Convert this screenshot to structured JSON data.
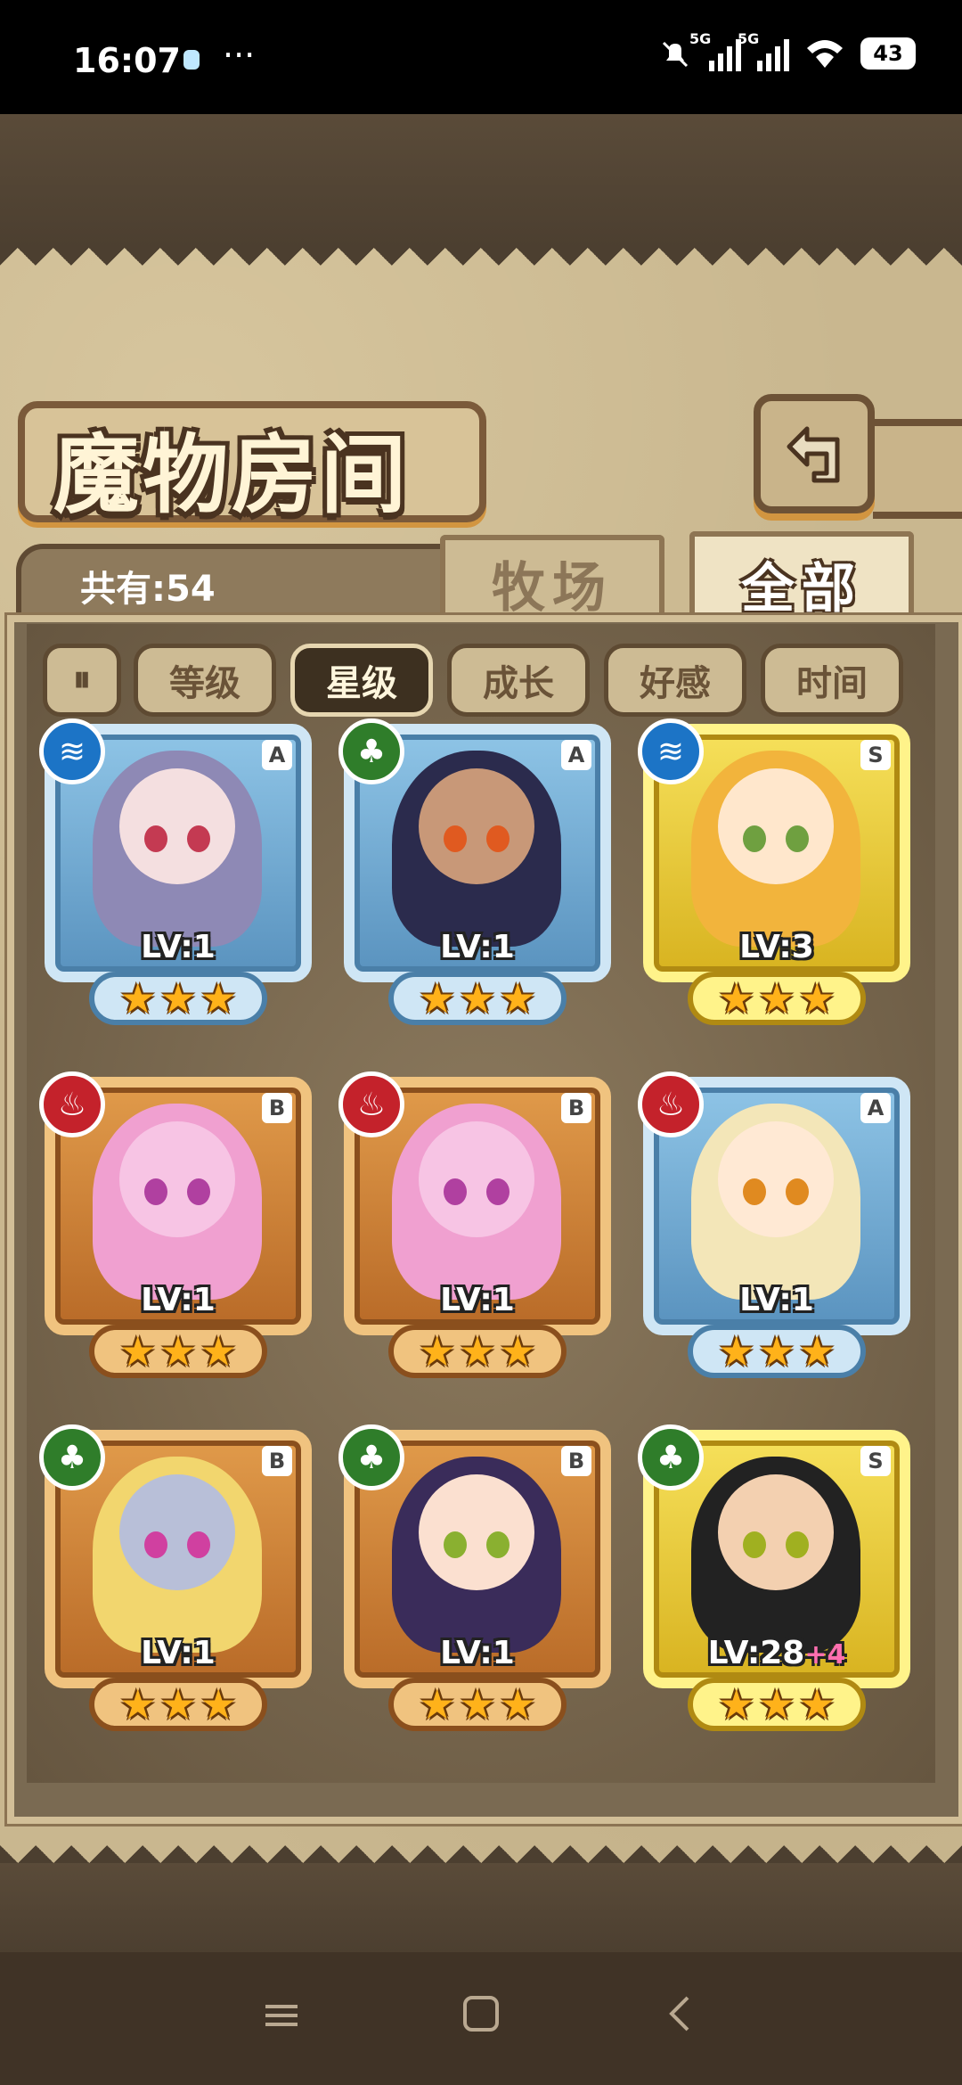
{
  "status_bar": {
    "time": "16:07",
    "dots": "···",
    "network1": "5G",
    "network2": "5G",
    "battery": "43"
  },
  "header": {
    "title": "魔物房间"
  },
  "tabs": {
    "count_label": "共有:54",
    "ranch": "牧场",
    "all": "全部",
    "active": "all"
  },
  "sort": {
    "toggle_icon": "sort-order-icon",
    "buttons": [
      {
        "label": "等级",
        "active": false
      },
      {
        "label": "星级",
        "active": true
      },
      {
        "label": "成长",
        "active": false
      },
      {
        "label": "好感",
        "active": false
      },
      {
        "label": "时间",
        "active": false
      }
    ]
  },
  "monsters": [
    {
      "element": "water",
      "rank": "A",
      "level": "LV:1",
      "bonus": "",
      "stars": 3,
      "hair": "#8e89b5",
      "skin": "#f4dfe0",
      "eyes": "#c43a52"
    },
    {
      "element": "grass",
      "rank": "A",
      "level": "LV:1",
      "bonus": "",
      "stars": 3,
      "hair": "#2b2b4d",
      "skin": "#c89878",
      "eyes": "#e05a20"
    },
    {
      "element": "water",
      "rank": "S",
      "level": "LV:3",
      "bonus": "",
      "stars": 3,
      "hair": "#f2b43c",
      "skin": "#ffe7cc",
      "eyes": "#6fa040"
    },
    {
      "element": "fire",
      "rank": "B",
      "level": "LV:1",
      "bonus": "",
      "stars": 3,
      "hair": "#f0a0d0",
      "skin": "#f7c4e4",
      "eyes": "#b040a0"
    },
    {
      "element": "fire",
      "rank": "B",
      "level": "LV:1",
      "bonus": "",
      "stars": 3,
      "hair": "#f0a0d0",
      "skin": "#f7c4e4",
      "eyes": "#b040a0"
    },
    {
      "element": "fire",
      "rank": "A",
      "level": "LV:1",
      "bonus": "",
      "stars": 3,
      "hair": "#f3e6b8",
      "skin": "#ffe9d4",
      "eyes": "#e08a20"
    },
    {
      "element": "grass",
      "rank": "B",
      "level": "LV:1",
      "bonus": "",
      "stars": 3,
      "hair": "#f2d66e",
      "skin": "#b8bfd8",
      "eyes": "#d040a0"
    },
    {
      "element": "grass",
      "rank": "B",
      "level": "LV:1",
      "bonus": "",
      "stars": 3,
      "hair": "#3a2c5a",
      "skin": "#fbe0d0",
      "eyes": "#8ab030"
    },
    {
      "element": "grass",
      "rank": "S",
      "level": "LV:28",
      "bonus": "+4",
      "stars": 3,
      "hair": "#222222",
      "skin": "#f3d0b0",
      "eyes": "#a0b020"
    }
  ],
  "nav": {
    "menu_icon": "menu-icon",
    "home_icon": "home-icon",
    "back_icon": "back-icon"
  },
  "colors": {
    "rank_A": "#8ec4e6",
    "rank_B": "#e09a4a",
    "rank_S": "#f6e05a",
    "water": "#1c74c6",
    "grass": "#2f7d2a",
    "fire": "#c4222b"
  }
}
